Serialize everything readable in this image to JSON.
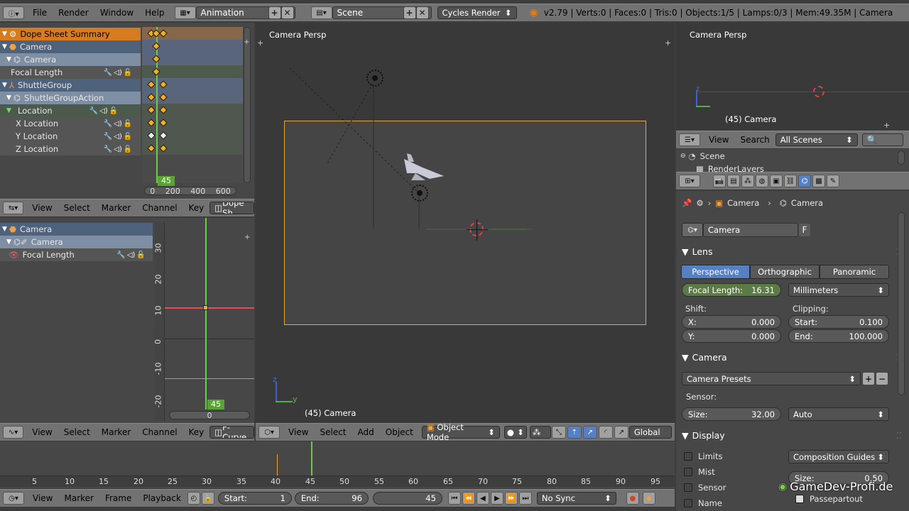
{
  "topbar": {
    "menus": [
      "File",
      "Render",
      "Window",
      "Help"
    ],
    "layout": "Animation",
    "scene": "Scene",
    "engine": "Cycles Render",
    "stats": "v2.79 | Verts:0 | Faces:0 | Tris:0 | Objects:1/5 | Lamps:0/3 | Mem:49.35M | Camera"
  },
  "dopesheet": {
    "rows": [
      {
        "label": "Dope Sheet Summary",
        "kind": "summary"
      },
      {
        "label": "Camera",
        "kind": "object"
      },
      {
        "label": "Camera",
        "kind": "action"
      },
      {
        "label": "Focal Length",
        "kind": "channel"
      },
      {
        "label": "ShuttleGroup",
        "kind": "object"
      },
      {
        "label": "ShuttleGroupAction",
        "kind": "action"
      },
      {
        "label": "Location",
        "kind": "group"
      },
      {
        "label": "X Location",
        "kind": "channel"
      },
      {
        "label": "Y Location",
        "kind": "channel"
      },
      {
        "label": "Z Location",
        "kind": "channel"
      }
    ],
    "current_frame": "45",
    "scale": [
      "0",
      "200",
      "400",
      "600"
    ],
    "header": {
      "menus": [
        "View",
        "Select",
        "Marker",
        "Channel",
        "Key"
      ],
      "mode": "Dope Sh"
    }
  },
  "graph": {
    "rows": [
      {
        "label": "Camera"
      },
      {
        "label": "Camera"
      },
      {
        "label": "Focal Length"
      }
    ],
    "yticks": [
      "30",
      "20",
      "10",
      "0",
      "-10",
      "-20"
    ],
    "current_frame": "45",
    "xzero": "0",
    "header": {
      "menus": [
        "View",
        "Select",
        "Marker",
        "Channel",
        "Key"
      ],
      "mode": "F-Curve"
    }
  },
  "viewport": {
    "label": "Camera Persp",
    "object": "(45) Camera",
    "axis_y": "y",
    "axis_z": "z",
    "header": {
      "menus": [
        "View",
        "Select",
        "Add",
        "Object"
      ],
      "mode": "Object Mode",
      "orientation": "Global"
    }
  },
  "preview": {
    "label": "Camera Persp",
    "object": "(45) Camera",
    "axis_z": "z"
  },
  "outliner": {
    "menus": [
      "View",
      "Search"
    ],
    "filter": "All Scenes",
    "items": [
      "Scene",
      "RenderLayers"
    ]
  },
  "properties": {
    "breadcrumb": [
      "Camera",
      "Camera"
    ],
    "datablock": "Camera",
    "fake_user": "F",
    "lens": {
      "title": "Lens",
      "tabs": [
        "Perspective",
        "Orthographic",
        "Panoramic"
      ],
      "focal_label": "Focal Length:",
      "focal_value": "16.31",
      "unit": "Millimeters",
      "shift_label": "Shift:",
      "shift_x_label": "X:",
      "shift_x": "0.000",
      "shift_y_label": "Y:",
      "shift_y": "0.000",
      "clip_label": "Clipping:",
      "clip_start_label": "Start:",
      "clip_start": "0.100",
      "clip_end_label": "End:",
      "clip_end": "100.000"
    },
    "camera": {
      "title": "Camera",
      "presets": "Camera Presets",
      "sensor_label": "Sensor:",
      "size_label": "Size:",
      "size_value": "32.00",
      "fit": "Auto"
    },
    "display": {
      "title": "Display",
      "checks": [
        "Limits",
        "Mist",
        "Sensor",
        "Name"
      ],
      "guides": "Composition Guides",
      "size_label": "Size:",
      "size_value": "0.50",
      "passepartout": "Passepartout"
    }
  },
  "timeline": {
    "ticks": [
      "5",
      "10",
      "15",
      "20",
      "25",
      "30",
      "35",
      "40",
      "45",
      "50",
      "55",
      "60",
      "65",
      "70",
      "75",
      "80",
      "85",
      "90",
      "95"
    ],
    "menus": [
      "View",
      "Marker",
      "Frame",
      "Playback"
    ],
    "start_label": "Start:",
    "start": "1",
    "end_label": "End:",
    "end": "96",
    "current": "45",
    "sync": "No Sync"
  },
  "watermark": "GameDev-Profi.de"
}
